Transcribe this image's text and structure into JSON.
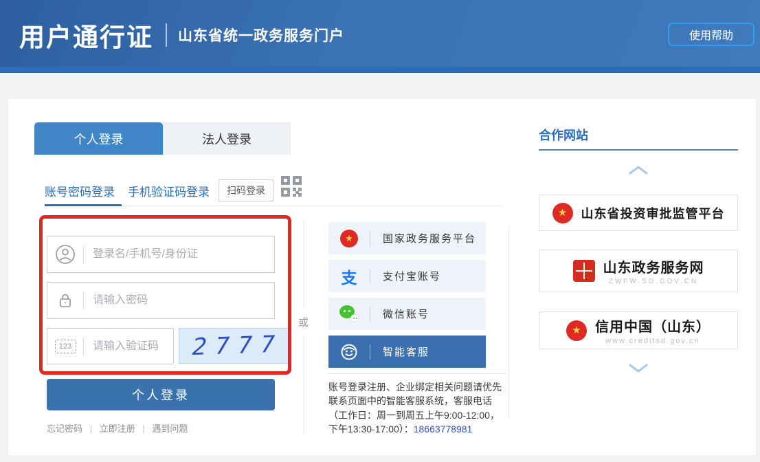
{
  "header": {
    "brand": "用户通行证",
    "portal": "山东省统一政务服务门户",
    "help_button": "使用帮助"
  },
  "tabs": {
    "personal": "个人登录",
    "legal": "法人登录"
  },
  "login_methods": {
    "password": "账号密码登录",
    "sms": "手机验证码登录",
    "qr": "扫码登录"
  },
  "form": {
    "username_placeholder": "登录名/手机号/身份证",
    "password_placeholder": "请输入密码",
    "captcha_placeholder": "请输入验证码",
    "captcha_badge": "123",
    "captcha_value": "2777",
    "submit_label": "个人登录",
    "link_forgot": "忘记密码",
    "link_register": "立即注册",
    "link_problem": "遇到问题",
    "link_separator": "|"
  },
  "divider": {
    "or_label": "或"
  },
  "third_party": {
    "items": [
      {
        "label": "国家政务服务平台",
        "icon": "national-emblem-icon",
        "active": false
      },
      {
        "label": "支付宝账号",
        "icon": "alipay-icon",
        "active": false
      },
      {
        "label": "微信账号",
        "icon": "wechat-icon",
        "active": false
      },
      {
        "label": "智能客服",
        "icon": "customer-service-icon",
        "active": true
      }
    ],
    "alipay_glyph": "支",
    "notice_text": "账号登录注册、企业绑定相关问题请优先联系页面中的智能客服系统，客服电话（工作日：周一到周五上午9:00-12:00，下午13:30-17:00）：",
    "notice_phone": "18663778981"
  },
  "sidebar": {
    "title": "合作网站",
    "cards": [
      {
        "title": "山东省投资审批监管平台",
        "subtitle": ""
      },
      {
        "title": "山东政务服务网",
        "subtitle": "ZWFW.SD.GOV.CN"
      },
      {
        "title": "信用中国（山东）",
        "subtitle": "www.creditsd.gov.cn"
      }
    ]
  },
  "colors": {
    "header_blue": "#3a72b4",
    "active_tab_blue": "#3f86c8",
    "button_blue": "#3a72ae",
    "link_blue": "#2b6fc2",
    "annotation_red": "#e5251c",
    "captcha_bg": "#dcebf8",
    "alipay_blue": "#1678ff",
    "wechat_green": "#43c32e",
    "emblem_red": "#dd2a22"
  }
}
